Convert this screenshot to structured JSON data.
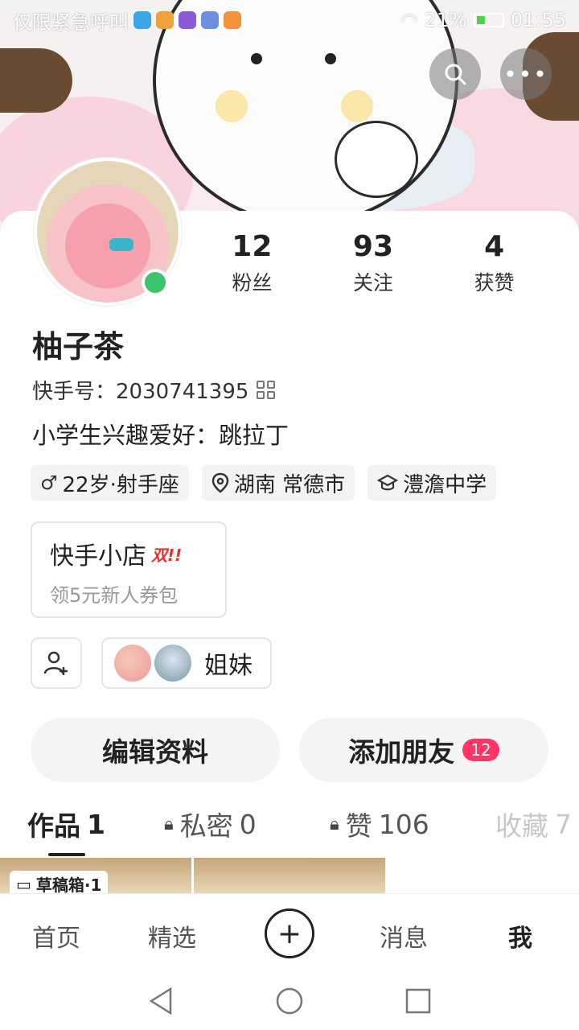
{
  "statusbar": {
    "carrier": "仅限紧急呼叫",
    "battery": "21%",
    "time": "01:55"
  },
  "profile": {
    "name": "柚子茶",
    "kuaishou_id_label": "快手号：2030741395",
    "bio": "小学生兴趣爱好：跳拉丁",
    "stats": [
      {
        "value": "12",
        "label": "粉丝"
      },
      {
        "value": "93",
        "label": "关注"
      },
      {
        "value": "4",
        "label": "获赞"
      }
    ],
    "tags": [
      {
        "icon": "gender-icon",
        "label": "22岁·射手座"
      },
      {
        "icon": "location-icon",
        "label": "湖南 常德市"
      },
      {
        "icon": "school-icon",
        "label": "澧澹中学"
      }
    ]
  },
  "shop": {
    "title": "快手小店",
    "badge": "双!!",
    "subtitle": "领5元新人券包"
  },
  "group": {
    "label": "姐妹"
  },
  "buttons": {
    "edit": "编辑资料",
    "add_friend": "添加朋友",
    "add_friend_count": "12"
  },
  "tabs": [
    {
      "label": "作品",
      "count": "1"
    },
    {
      "label": "私密",
      "count": "0"
    },
    {
      "label": "赞",
      "count": "106"
    },
    {
      "label": "收藏",
      "count": "7"
    }
  ],
  "draft": {
    "label": "草稿箱·1"
  },
  "bottom_nav": {
    "home": "首页",
    "featured": "精选",
    "messages": "消息",
    "me": "我"
  },
  "colors": {
    "accent_pink": "#fe3666",
    "online_green": "#3bc46b"
  }
}
